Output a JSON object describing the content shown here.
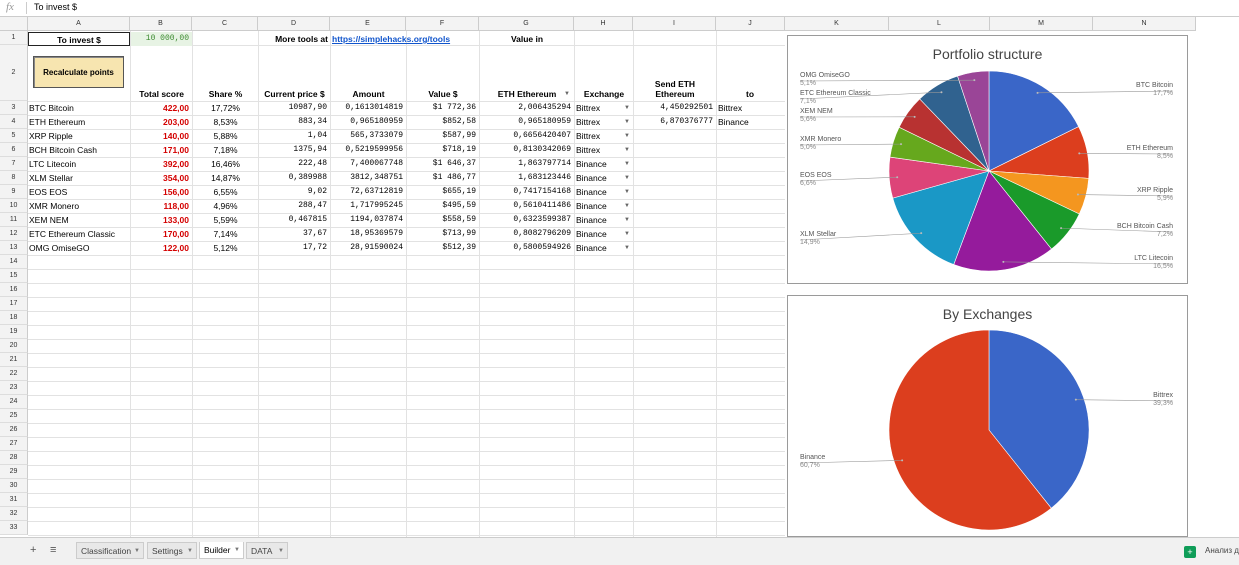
{
  "formula_bar": {
    "fx_label": "fx",
    "value": "To invest $"
  },
  "columns": [
    "A",
    "B",
    "C",
    "D",
    "E",
    "F",
    "G",
    "H",
    "I",
    "J",
    "K",
    "L",
    "M",
    "N"
  ],
  "rows": [
    "1",
    "2",
    "3",
    "4",
    "5",
    "6",
    "7",
    "8",
    "9",
    "10",
    "11",
    "12",
    "13",
    "14",
    "15",
    "16",
    "17",
    "18",
    "19",
    "20",
    "21",
    "22",
    "23",
    "24",
    "25",
    "26",
    "27",
    "28",
    "29",
    "30",
    "31",
    "32",
    "33"
  ],
  "header_row1": {
    "to_invest_label": "To invest $",
    "to_invest_value": "10 000,00",
    "more_tools": "More tools at",
    "link": "https://simplehacks.org/tools",
    "value_in": "Value in"
  },
  "button": {
    "recalc": "Recalculate points"
  },
  "header_row2": {
    "total_score": "Total score",
    "share": "Share %",
    "current_price": "Current price $",
    "amount": "Amount",
    "value_usd": "Value $",
    "eth": "ETH Ethereum",
    "exchange": "Exchange",
    "send_eth": "Send ETH",
    "send_eth2": "Ethereum",
    "to": "to"
  },
  "table": [
    {
      "name": "BTC Bitcoin",
      "score": "422,00",
      "share": "17,72%",
      "price": "10987,90",
      "amount": "0,1613014819",
      "value": "$1 772,36",
      "eth": "2,006435294",
      "exchange": "Bittrex",
      "send": "4,450292501",
      "to": "Bittrex"
    },
    {
      "name": "ETH Ethereum",
      "score": "203,00",
      "share": "8,53%",
      "price": "883,34",
      "amount": "0,965180959",
      "value": "$852,58",
      "eth": "0,965180959",
      "exchange": "Bittrex",
      "send": "6,870376777",
      "to": "Binance"
    },
    {
      "name": "XRP Ripple",
      "score": "140,00",
      "share": "5,88%",
      "price": "1,04",
      "amount": "565,3733079",
      "value": "$587,99",
      "eth": "0,6656420407",
      "exchange": "Bittrex",
      "send": "",
      "to": ""
    },
    {
      "name": "BCH Bitcoin Cash",
      "score": "171,00",
      "share": "7,18%",
      "price": "1375,94",
      "amount": "0,5219599956",
      "value": "$718,19",
      "eth": "0,8130342069",
      "exchange": "Bittrex",
      "send": "",
      "to": ""
    },
    {
      "name": "LTC Litecoin",
      "score": "392,00",
      "share": "16,46%",
      "price": "222,48",
      "amount": "7,400067748",
      "value": "$1 646,37",
      "eth": "1,863797714",
      "exchange": "Binance",
      "send": "",
      "to": ""
    },
    {
      "name": "XLM Stellar",
      "score": "354,00",
      "share": "14,87%",
      "price": "0,389988",
      "amount": "3812,348751",
      "value": "$1 486,77",
      "eth": "1,683123446",
      "exchange": "Binance",
      "send": "",
      "to": ""
    },
    {
      "name": "EOS EOS",
      "score": "156,00",
      "share": "6,55%",
      "price": "9,02",
      "amount": "72,63712819",
      "value": "$655,19",
      "eth": "0,7417154168",
      "exchange": "Binance",
      "send": "",
      "to": ""
    },
    {
      "name": "XMR Monero",
      "score": "118,00",
      "share": "4,96%",
      "price": "288,47",
      "amount": "1,717995245",
      "value": "$495,59",
      "eth": "0,5610411486",
      "exchange": "Binance",
      "send": "",
      "to": ""
    },
    {
      "name": "XEM NEM",
      "score": "133,00",
      "share": "5,59%",
      "price": "0,467815",
      "amount": "1194,037874",
      "value": "$558,59",
      "eth": "0,6323599387",
      "exchange": "Binance",
      "send": "",
      "to": ""
    },
    {
      "name": "ETC Ethereum Classic",
      "score": "170,00",
      "share": "7,14%",
      "price": "37,67",
      "amount": "18,95369579",
      "value": "$713,99",
      "eth": "0,8082796209",
      "exchange": "Binance",
      "send": "",
      "to": ""
    },
    {
      "name": "OMG OmiseGO",
      "score": "122,00",
      "share": "5,12%",
      "price": "17,72",
      "amount": "28,91590024",
      "value": "$512,39",
      "eth": "0,5800594926",
      "exchange": "Binance",
      "send": "",
      "to": ""
    }
  ],
  "chart_data": [
    {
      "type": "pie",
      "title": "Portfolio structure",
      "categories": [
        "BTC Bitcoin",
        "ETH Ethereum",
        "XRP Ripple",
        "BCH Bitcoin Cash",
        "LTC Litecoin",
        "XLM Stellar",
        "EOS EOS",
        "XMR Monero",
        "XEM NEM",
        "ETC Ethereum Classic",
        "OMG OmiseGO"
      ],
      "values": [
        17.7,
        8.5,
        5.9,
        7.2,
        16.5,
        14.9,
        6.6,
        5.0,
        5.6,
        7.1,
        5.1
      ],
      "labels": [
        "17,7%",
        "8,5%",
        "5,9%",
        "7,2%",
        "16,5%",
        "14,9%",
        "6,6%",
        "5,0%",
        "5,6%",
        "7,1%",
        "5,1%"
      ],
      "colors": [
        "#3a66c8",
        "#dc3e1e",
        "#f4961f",
        "#1a9a2a",
        "#951b9c",
        "#1a98c6",
        "#dd4478",
        "#66a81d",
        "#b83231",
        "#30628f",
        "#9a4597"
      ]
    },
    {
      "type": "pie",
      "title": "By Exchanges",
      "categories": [
        "Bittrex",
        "Binance"
      ],
      "values": [
        39.3,
        60.7
      ],
      "labels": [
        "39,3%",
        "60,7%"
      ],
      "colors": [
        "#3a66c8",
        "#dc3e1e"
      ]
    }
  ],
  "sheet_tabs": [
    "Classification",
    "Settings",
    "Builder",
    "DATA"
  ],
  "active_tab": "Builder",
  "explore": "Анализ д"
}
